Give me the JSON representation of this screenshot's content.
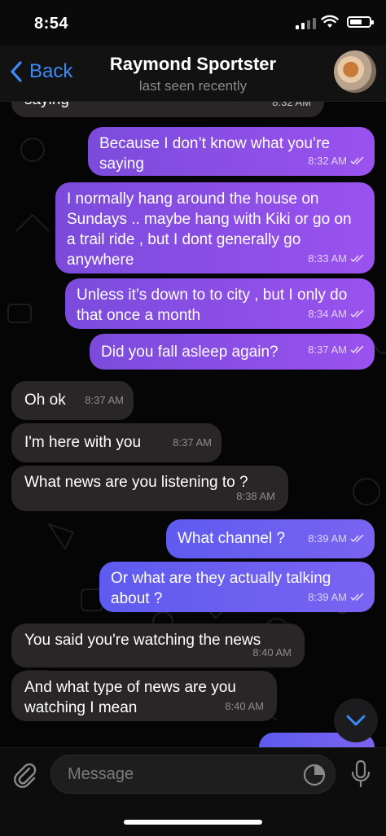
{
  "status": {
    "time": "8:54"
  },
  "nav": {
    "back_label": "Back",
    "title": "Raymond Sportster",
    "subtitle": "last seen recently"
  },
  "messages": [
    {
      "dir": "out",
      "text": "saying",
      "time": "8:32 AM"
    },
    {
      "dir": "out",
      "text": "Because I don’t know what you’re saying",
      "time": "8:32 AM"
    },
    {
      "dir": "out",
      "text": "I normally hang around the house on Sundays .. maybe hang with Kiki or go on a trail ride , but I dont generally go anywhere",
      "time": "8:33 AM"
    },
    {
      "dir": "out",
      "text": "Unless it’s down to to city , but I only do that once a month",
      "time": "8:34 AM"
    },
    {
      "dir": "out",
      "text": "Did you fall asleep again?",
      "time": "8:37 AM"
    },
    {
      "dir": "in",
      "text": "Oh ok",
      "time": "8:37 AM"
    },
    {
      "dir": "in",
      "text": "I'm here with you",
      "time": "8:37 AM"
    },
    {
      "dir": "in",
      "text": "What news are you listening to ?",
      "time": "8:38 AM"
    },
    {
      "dir": "out",
      "text": "What channel ?",
      "time": "8:39 AM"
    },
    {
      "dir": "out",
      "text": "Or what are they actually talking about ?",
      "time": "8:39 AM"
    },
    {
      "dir": "in",
      "text": "You said you're watching the news",
      "time": "8:40 AM"
    },
    {
      "dir": "in",
      "text": "And what type of news are you watching I mean",
      "time": "8:40 AM"
    }
  ],
  "input": {
    "placeholder": "Message"
  },
  "icons": {
    "attach": "paperclip-icon",
    "sticker": "sticker-icon",
    "mic": "microphone-icon",
    "scroll": "chevron-down-icon",
    "back": "chevron-left-icon"
  }
}
